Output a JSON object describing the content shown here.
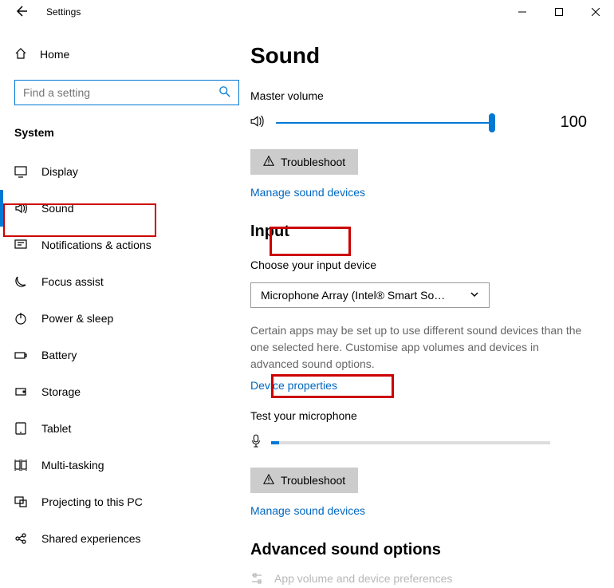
{
  "window": {
    "title": "Settings"
  },
  "sidebar": {
    "home": "Home",
    "search_placeholder": "Find a setting",
    "section": "System",
    "items": [
      {
        "label": "Display"
      },
      {
        "label": "Sound"
      },
      {
        "label": "Notifications & actions"
      },
      {
        "label": "Focus assist"
      },
      {
        "label": "Power & sleep"
      },
      {
        "label": "Battery"
      },
      {
        "label": "Storage"
      },
      {
        "label": "Tablet"
      },
      {
        "label": "Multi-tasking"
      },
      {
        "label": "Projecting to this PC"
      },
      {
        "label": "Shared experiences"
      }
    ]
  },
  "main": {
    "title": "Sound",
    "master_volume_label": "Master volume",
    "volume_value": "100",
    "troubleshoot": "Troubleshoot",
    "manage_link": "Manage sound devices",
    "input_section": "Input",
    "choose_input": "Choose your input device",
    "input_device": "Microphone Array (Intel® Smart So…",
    "input_help": "Certain apps may be set up to use different sound devices than the one selected here. Customise app volumes and devices in advanced sound options.",
    "device_properties": "Device properties",
    "test_mic": "Test your microphone",
    "advanced": "Advanced sound options",
    "app_prefs": "App volume and device preferences"
  }
}
